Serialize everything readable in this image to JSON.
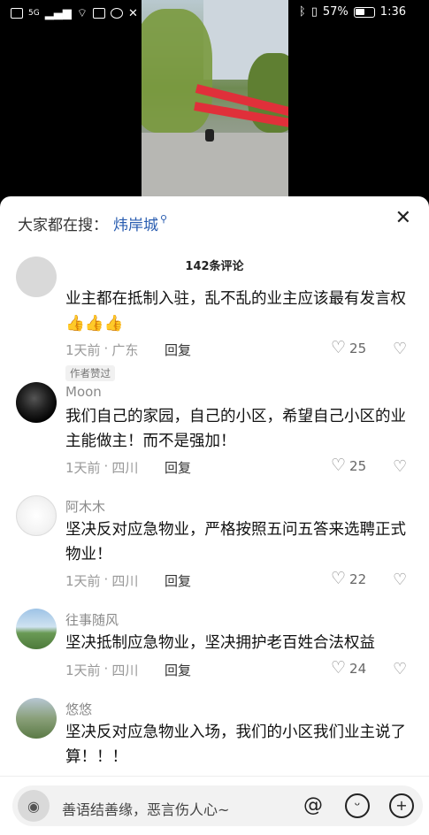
{
  "status": {
    "network": "5G",
    "battery": "57%",
    "battery_level": 0.57,
    "time": "1:36"
  },
  "search_bar": {
    "prefix": "大家都在搜：",
    "term": "炜岸城",
    "close_icon": "close-icon"
  },
  "comments_header": {
    "count_label": "142条评论"
  },
  "comments": [
    {
      "username": "",
      "text": "业主都在抵制入驻，乱不乱的业主应该最有发言权👍👍👍",
      "time": "1天前",
      "location": "广东",
      "reply": "回复",
      "likes": "25",
      "tag": "作者赞过"
    },
    {
      "username": "Moon",
      "text": "我们自己的家园，自己的小区，希望自己小区的业主能做主！而不是强加！",
      "time": "1天前",
      "location": "四川",
      "reply": "回复",
      "likes": "25"
    },
    {
      "username": "阿木木",
      "text": "坚决反对应急物业，严格按照五问五答来选聘正式物业！",
      "time": "1天前",
      "location": "四川",
      "reply": "回复",
      "likes": "22"
    },
    {
      "username": "往事随风",
      "text": "坚决抵制应急物业，坚决拥护老百姓合法权益",
      "time": "1天前",
      "location": "四川",
      "reply": "回复",
      "likes": "24"
    },
    {
      "username": "悠悠",
      "text": "坚决反对应急物业入场，我们的小区我们业主说了算！！！"
    }
  ],
  "input_bar": {
    "placeholder": "善语结善缘，恶言伤人心~",
    "icons": [
      "camera-icon",
      "at-icon",
      "emoji-icon",
      "plus-icon"
    ]
  }
}
